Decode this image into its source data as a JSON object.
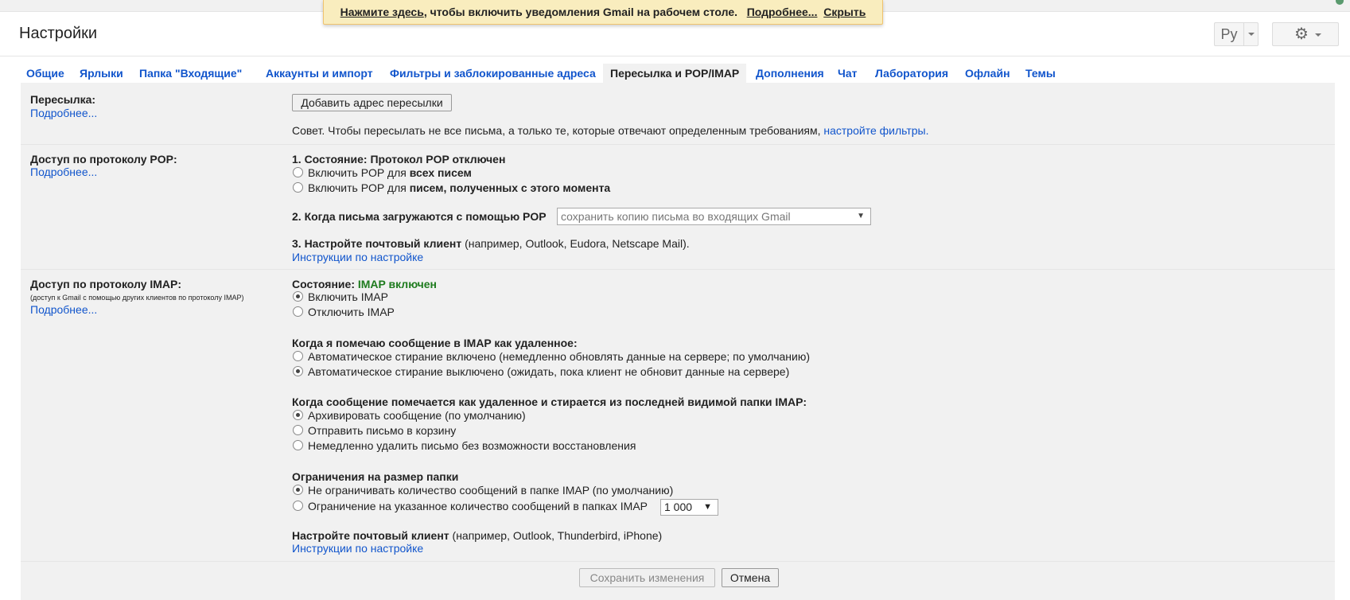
{
  "notification": {
    "link_click": "Нажмите здесь",
    "text": ", чтобы включить уведомления Gmail на рабочем столе.",
    "more": "Подробнее...",
    "hide": "Скрыть"
  },
  "header": {
    "title": "Настройки",
    "lang_label": "Ру"
  },
  "tabs": [
    {
      "label": "Общие"
    },
    {
      "label": "Ярлыки"
    },
    {
      "label": "Папка \"Входящие\""
    },
    {
      "label": "Аккаунты и импорт"
    },
    {
      "label": "Фильтры и заблокированные адреса"
    },
    {
      "label": "Пересылка и POP/IMAP"
    },
    {
      "label": "Дополнения"
    },
    {
      "label": "Чат"
    },
    {
      "label": "Лаборатория"
    },
    {
      "label": "Офлайн"
    },
    {
      "label": "Темы"
    }
  ],
  "forwarding": {
    "title": "Пересылка:",
    "more": "Подробнее...",
    "add_button": "Добавить адрес пересылки",
    "tip": "Совет. Чтобы пересылать не все письма, а только те, которые отвечают определенным требованиям,",
    "tip_link": "настройте фильтры."
  },
  "pop": {
    "title": "Доступ по протоколу POP:",
    "more": "Подробнее...",
    "status_label": "1. Состояние: Протокол POP отключен",
    "opt_all_prefix": "Включить POP для",
    "opt_all_bold": "всех писем",
    "opt_now_prefix": "Включить POP для",
    "opt_now_bold": "писем, полученных с этого момента",
    "when_label": "2. Когда письма загружаются с помощью POP",
    "when_select": "сохранить копию письма во входящих Gmail",
    "client_label": "3. Настройте почтовый клиент",
    "client_example": "(например, Outlook, Eudora, Netscape Mail).",
    "instructions": "Инструкции по настройке"
  },
  "imap": {
    "title": "Доступ по протоколу IMAP:",
    "subtitle": "(доступ к Gmail с помощью других клиентов по протоколу IMAP)",
    "more": "Подробнее...",
    "status_label": "Состояние:",
    "status_value": "IMAP включен",
    "enable": "Включить IMAP",
    "disable": "Отключить IMAP",
    "deleted_heading": "Когда я помечаю сообщение в IMAP как удаленное:",
    "expunge_on": "Автоматическое стирание включено (немедленно обновлять данные на сервере; по умолчанию)",
    "expunge_off": "Автоматическое стирание выключено (ожидать, пока клиент не обновит данные на сервере)",
    "expunged_heading": "Когда сообщение помечается как удаленное и стирается из последней видимой папки IMAP:",
    "archive": "Архивировать сообщение (по умолчанию)",
    "trash": "Отправить письмо в корзину",
    "delete_forever": "Немедленно удалить письмо без возможности восстановления",
    "folder_limit_heading": "Ограничения на размер папки",
    "no_limit": "Не ограничивать количество сообщений в папке IMAP (по умолчанию)",
    "limit": "Ограничение на указанное количество сообщений в папках IMAP",
    "limit_value": "1 000",
    "client_label": "Настройте почтовый клиент",
    "client_example": "(например, Outlook, Thunderbird, iPhone)",
    "instructions": "Инструкции по настройке"
  },
  "footer": {
    "save": "Сохранить изменения",
    "cancel": "Отмена"
  },
  "colors": {
    "link": "#1155cc",
    "status_green": "#1e7b1e",
    "notification_bg": "#f9edbe"
  }
}
